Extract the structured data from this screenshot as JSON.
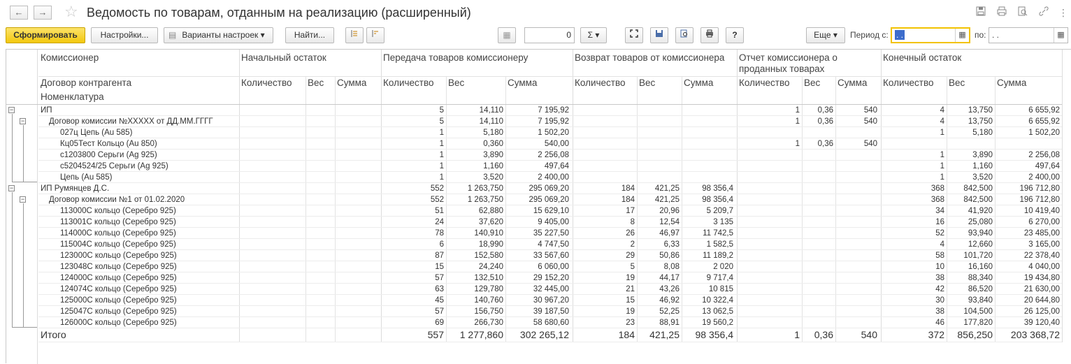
{
  "window": {
    "title": "Ведомость по товарам, отданным на реализацию (расширенный)",
    "back_icon": "←",
    "forward_icon": "→",
    "star_icon": "☆"
  },
  "toolbar": {
    "generate_label": "Сформировать",
    "settings_label": "Настройки...",
    "variants_label": "Варианты настроек ▾",
    "find_label": "Найти...",
    "counter_value": "0",
    "sum_label": "Σ ▾",
    "more_label": "Еще ▾",
    "period_from_label": "Период с:",
    "period_from_value": " .  . ",
    "period_to_label": "по:",
    "period_to_value": " .  . ",
    "help_label": "?"
  },
  "report": {
    "headers": {
      "commissioner": "Комиссионер",
      "contract": "Договор контрагента",
      "nomenclature": "Номенклатура",
      "groups": [
        "Начальный остаток",
        "Передача товаров комиссионеру",
        "Возврат товаров от комиссионера",
        "Отчет комиссионера о проданных товарах",
        "Конечный остаток"
      ],
      "qty": "Количество",
      "weight": "Вес",
      "sum": "Сумма"
    },
    "rows": [
      {
        "level": 0,
        "name": "ИП",
        "v": [
          "",
          "",
          "",
          "5",
          "14,110",
          "7 195,92",
          "",
          "",
          "",
          "1",
          "0,36",
          "540",
          "4",
          "13,750",
          "6 655,92"
        ]
      },
      {
        "level": 1,
        "name": "Договор комиссии №XXXXX от ДД.ММ.ГГГГ",
        "v": [
          "",
          "",
          "",
          "5",
          "14,110",
          "7 195,92",
          "",
          "",
          "",
          "1",
          "0,36",
          "540",
          "4",
          "13,750",
          "6 655,92"
        ]
      },
      {
        "level": 2,
        "name": "027ц Цепь (Au 585)",
        "v": [
          "",
          "",
          "",
          "1",
          "5,180",
          "1 502,20",
          "",
          "",
          "",
          "",
          "",
          "",
          "1",
          "5,180",
          "1 502,20"
        ]
      },
      {
        "level": 2,
        "name": "Кц05Тест Кольцо (Au 850)",
        "v": [
          "",
          "",
          "",
          "1",
          "0,360",
          "540,00",
          "",
          "",
          "",
          "1",
          "0,36",
          "540",
          "",
          "",
          ""
        ]
      },
      {
        "level": 2,
        "name": "с1203800 Серьги (Ag 925)",
        "v": [
          "",
          "",
          "",
          "1",
          "3,890",
          "2 256,08",
          "",
          "",
          "",
          "",
          "",
          "",
          "1",
          "3,890",
          "2 256,08"
        ]
      },
      {
        "level": 2,
        "name": "с5204524/25 Серьги (Ag 925)",
        "v": [
          "",
          "",
          "",
          "1",
          "1,160",
          "497,64",
          "",
          "",
          "",
          "",
          "",
          "",
          "1",
          "1,160",
          "497,64"
        ]
      },
      {
        "level": 2,
        "name": "Цепь (Au 585)",
        "v": [
          "",
          "",
          "",
          "1",
          "3,520",
          "2 400,00",
          "",
          "",
          "",
          "",
          "",
          "",
          "1",
          "3,520",
          "2 400,00"
        ]
      },
      {
        "level": 0,
        "name": "ИП Румянцев Д.С.",
        "v": [
          "",
          "",
          "",
          "552",
          "1 263,750",
          "295 069,20",
          "184",
          "421,25",
          "98 356,4",
          "",
          "",
          "",
          "368",
          "842,500",
          "196 712,80"
        ]
      },
      {
        "level": 1,
        "name": "Договор комиссии №1 от 01.02.2020",
        "v": [
          "",
          "",
          "",
          "552",
          "1 263,750",
          "295 069,20",
          "184",
          "421,25",
          "98 356,4",
          "",
          "",
          "",
          "368",
          "842,500",
          "196 712,80"
        ]
      },
      {
        "level": 2,
        "name": "113000С кольцо (Серебро 925)",
        "v": [
          "",
          "",
          "",
          "51",
          "62,880",
          "15 629,10",
          "17",
          "20,96",
          "5 209,7",
          "",
          "",
          "",
          "34",
          "41,920",
          "10 419,40"
        ]
      },
      {
        "level": 2,
        "name": "113001С кольцо (Серебро 925)",
        "v": [
          "",
          "",
          "",
          "24",
          "37,620",
          "9 405,00",
          "8",
          "12,54",
          "3 135",
          "",
          "",
          "",
          "16",
          "25,080",
          "6 270,00"
        ]
      },
      {
        "level": 2,
        "name": "114000С кольцо (Серебро 925)",
        "v": [
          "",
          "",
          "",
          "78",
          "140,910",
          "35 227,50",
          "26",
          "46,97",
          "11 742,5",
          "",
          "",
          "",
          "52",
          "93,940",
          "23 485,00"
        ]
      },
      {
        "level": 2,
        "name": "115004С кольцо (Серебро 925)",
        "v": [
          "",
          "",
          "",
          "6",
          "18,990",
          "4 747,50",
          "2",
          "6,33",
          "1 582,5",
          "",
          "",
          "",
          "4",
          "12,660",
          "3 165,00"
        ]
      },
      {
        "level": 2,
        "name": "123000С кольцо (Серебро 925)",
        "v": [
          "",
          "",
          "",
          "87",
          "152,580",
          "33 567,60",
          "29",
          "50,86",
          "11 189,2",
          "",
          "",
          "",
          "58",
          "101,720",
          "22 378,40"
        ]
      },
      {
        "level": 2,
        "name": "123048С кольцо (Серебро 925)",
        "v": [
          "",
          "",
          "",
          "15",
          "24,240",
          "6 060,00",
          "5",
          "8,08",
          "2 020",
          "",
          "",
          "",
          "10",
          "16,160",
          "4 040,00"
        ]
      },
      {
        "level": 2,
        "name": "124000С кольцо (Серебро 925)",
        "v": [
          "",
          "",
          "",
          "57",
          "132,510",
          "29 152,20",
          "19",
          "44,17",
          "9 717,4",
          "",
          "",
          "",
          "38",
          "88,340",
          "19 434,80"
        ]
      },
      {
        "level": 2,
        "name": "124074С кольцо (Серебро 925)",
        "v": [
          "",
          "",
          "",
          "63",
          "129,780",
          "32 445,00",
          "21",
          "43,26",
          "10 815",
          "",
          "",
          "",
          "42",
          "86,520",
          "21 630,00"
        ]
      },
      {
        "level": 2,
        "name": "125000С кольцо (Серебро 925)",
        "v": [
          "",
          "",
          "",
          "45",
          "140,760",
          "30 967,20",
          "15",
          "46,92",
          "10 322,4",
          "",
          "",
          "",
          "30",
          "93,840",
          "20 644,80"
        ]
      },
      {
        "level": 2,
        "name": "125047С кольцо (Серебро 925)",
        "v": [
          "",
          "",
          "",
          "57",
          "156,750",
          "39 187,50",
          "19",
          "52,25",
          "13 062,5",
          "",
          "",
          "",
          "38",
          "104,500",
          "26 125,00"
        ]
      },
      {
        "level": 2,
        "name": "126000С кольцо (Серебро 925)",
        "v": [
          "",
          "",
          "",
          "69",
          "266,730",
          "58 680,60",
          "23",
          "88,91",
          "19 560,2",
          "",
          "",
          "",
          "46",
          "177,820",
          "39 120,40"
        ]
      }
    ],
    "total": {
      "name": "Итого",
      "v": [
        "",
        "",
        "",
        "557",
        "1 277,860",
        "302 265,12",
        "184",
        "421,25",
        "98 356,4",
        "1",
        "0,36",
        "540",
        "372",
        "856,250",
        "203 368,72"
      ]
    }
  }
}
